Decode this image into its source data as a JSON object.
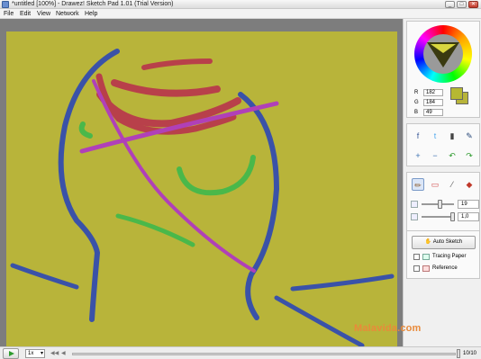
{
  "window": {
    "title": "*untitled [100%] - Drawez! Sketch Pad 1.01 (Trial Version)",
    "controls": {
      "minimize": "_",
      "maximize": "□",
      "close": "✕"
    }
  },
  "menu": [
    "File",
    "Edit",
    "View",
    "Network",
    "Help"
  ],
  "color": {
    "r_label": "R",
    "r_value": "182",
    "g_label": "G",
    "g_value": "184",
    "b_label": "B",
    "b_value": "49",
    "current_hex": "#b6b831"
  },
  "share_tools": [
    {
      "name": "facebook-icon",
      "glyph": "f",
      "color": "#3b5998"
    },
    {
      "name": "twitter-icon",
      "glyph": "t",
      "color": "#55acee"
    },
    {
      "name": "video-icon",
      "glyph": "▮",
      "color": "#444444"
    },
    {
      "name": "settings-icon",
      "glyph": "✎",
      "color": "#2a4a7a"
    }
  ],
  "view_tools": [
    {
      "name": "zoom-in-icon",
      "glyph": "+",
      "color": "#3a6fb0"
    },
    {
      "name": "zoom-out-icon",
      "glyph": "−",
      "color": "#3a6fb0"
    },
    {
      "name": "undo-icon",
      "glyph": "↶",
      "color": "#2e9b2e"
    },
    {
      "name": "redo-icon",
      "glyph": "↷",
      "color": "#2e9b2e"
    }
  ],
  "draw_tools": [
    {
      "name": "pencil-icon",
      "glyph": "✏",
      "color": "#8a5a2a"
    },
    {
      "name": "eraser-icon",
      "glyph": "▭",
      "color": "#d04a4a"
    },
    {
      "name": "eyedropper-icon",
      "glyph": "⁄",
      "color": "#555555"
    },
    {
      "name": "fill-icon",
      "glyph": "◆",
      "color": "#c0392b"
    }
  ],
  "brush": {
    "size_value": "19",
    "opacity_value": "1,0"
  },
  "auto_sketch": {
    "label": "Auto Sketch",
    "icon": "hand-icon"
  },
  "options": {
    "tracing_paper": "Tracing Paper",
    "reference": "Reference"
  },
  "watermark": "Malavida.com",
  "playback": {
    "speed": "1x",
    "frames": "10/10"
  },
  "canvas": {
    "background": "#b8b43a"
  }
}
